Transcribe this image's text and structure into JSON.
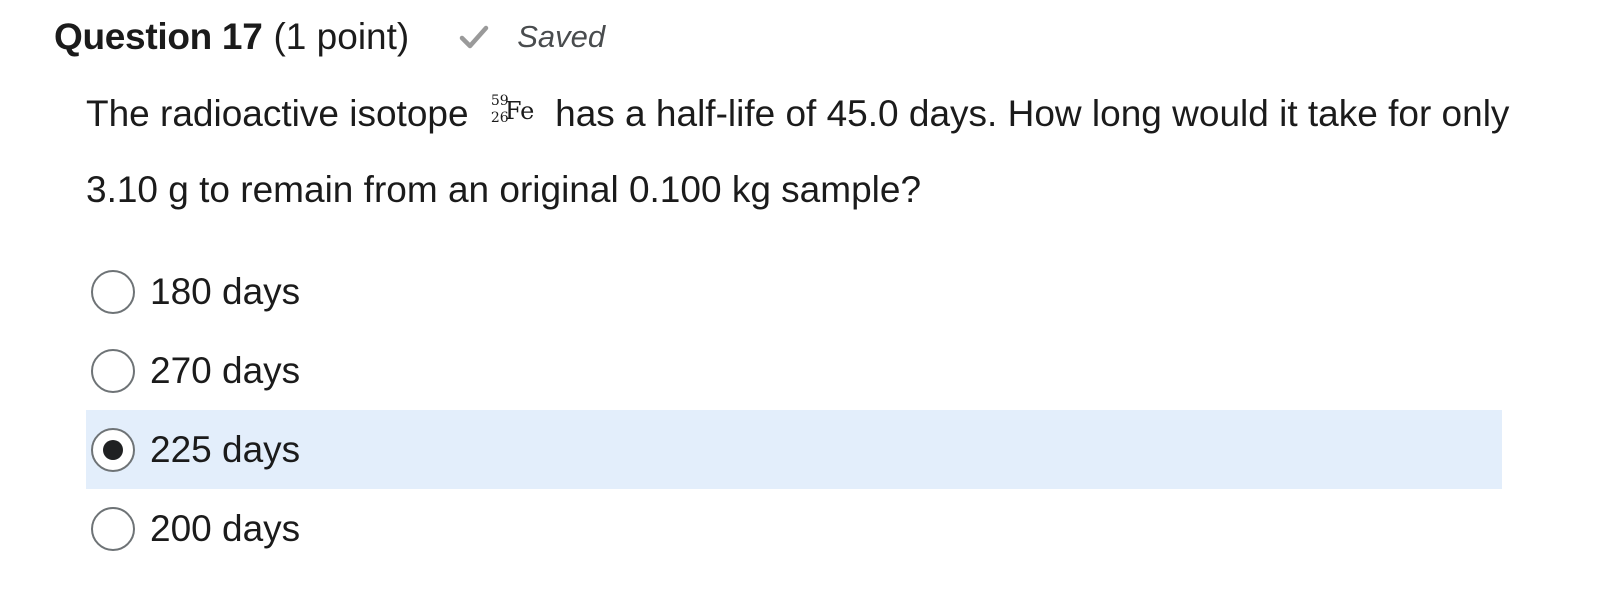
{
  "question": {
    "title": "Question 17",
    "points": "(1 point)",
    "status_icon": "checkmark-icon",
    "status": "Saved",
    "text_before_isotope": "The radioactive isotope ",
    "isotope": {
      "mass_number": "59",
      "atomic_number": "26",
      "symbol": "Fe"
    },
    "text_after_isotope": " has a half-life of 45.0 days. How long would it take for only 3.10 g to remain from an original 0.100 kg sample?"
  },
  "options": [
    {
      "label": "180 days",
      "selected": false
    },
    {
      "label": "270 days",
      "selected": false
    },
    {
      "label": "225 days",
      "selected": true
    },
    {
      "label": "200 days",
      "selected": false
    }
  ],
  "colors": {
    "selected_background": "#e3eefb",
    "check_icon": "#9a9a9a",
    "radio_border": "#6e7376"
  }
}
